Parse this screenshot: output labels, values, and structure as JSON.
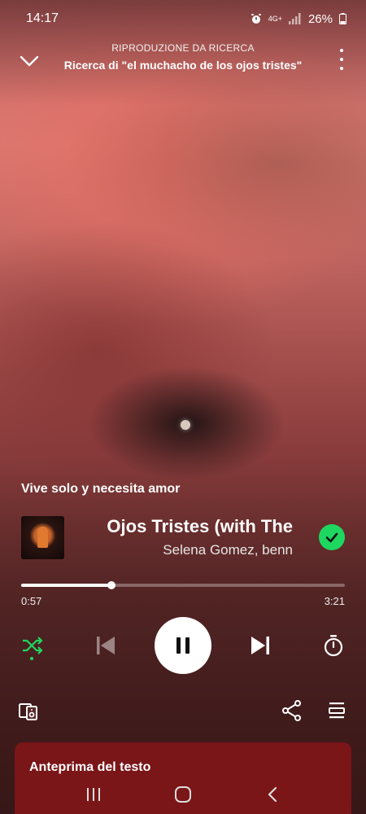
{
  "status_bar": {
    "time": "14:17",
    "network": "4G+",
    "battery": "26%",
    "icons": [
      "alarm-icon",
      "network-icon",
      "signal-icon",
      "battery-icon"
    ]
  },
  "header": {
    "context_label": "RIPRODUZIONE DA RICERCA",
    "title": "Ricerca di \"el muchacho de los ojos tristes\"",
    "icons": [
      "chevron-down-icon",
      "more-options-icon"
    ]
  },
  "canvas": {
    "caption": "Vive solo y necesita amor"
  },
  "track": {
    "title": "Ojos Tristes (with The",
    "artists": "Selena Gomez, benn",
    "liked": true
  },
  "progress": {
    "elapsed": "0:57",
    "total": "3:21",
    "fraction": 0.28
  },
  "controls": {
    "icons": [
      "shuffle-icon",
      "previous-icon",
      "pause-icon",
      "next-icon",
      "sleep-timer-icon"
    ],
    "shuffle_active": true
  },
  "actions": {
    "icons": [
      "connect-device-icon",
      "share-icon",
      "queue-icon"
    ]
  },
  "lyrics": {
    "title": "Anteprima del testo"
  },
  "nav_bar": {
    "icons": [
      "recent-apps-icon",
      "home-icon",
      "back-icon"
    ]
  },
  "colors": {
    "accent": "#1ed760",
    "lyrics_card": "#7a1518",
    "background": "#8a3c3c"
  }
}
